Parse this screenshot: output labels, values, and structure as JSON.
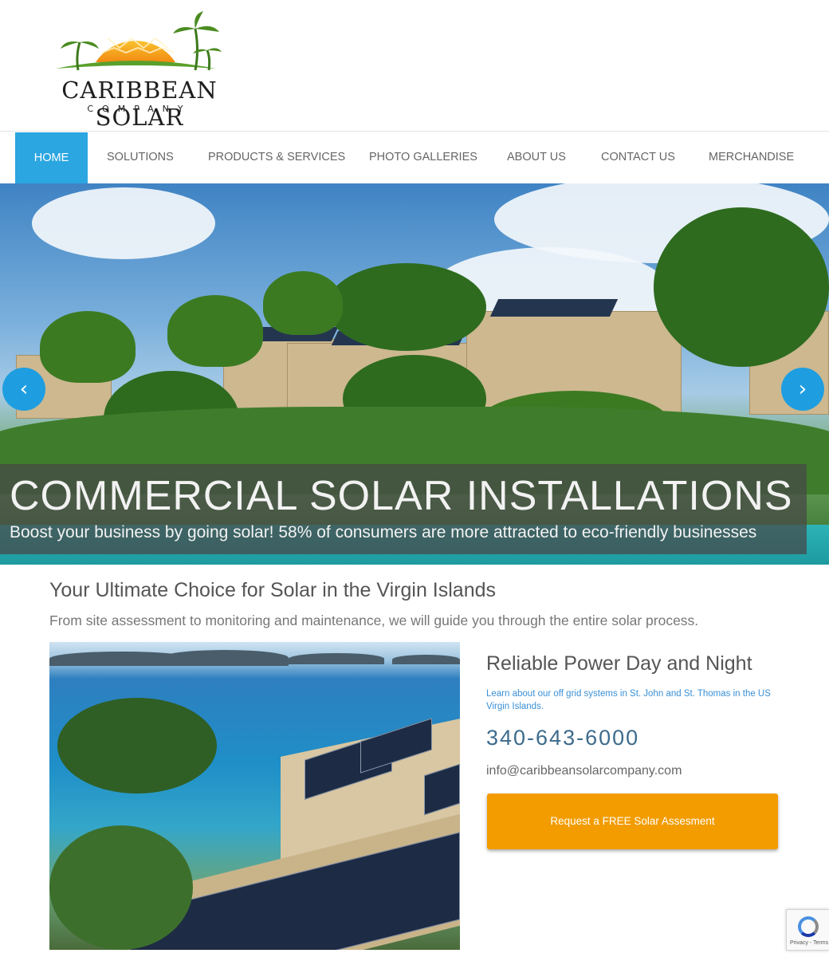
{
  "logo": {
    "name": "CARIBBEAN SOLAR",
    "sub": "COMPANY"
  },
  "nav": {
    "items": [
      {
        "label": "HOME",
        "active": true
      },
      {
        "label": "SOLUTIONS",
        "active": false
      },
      {
        "label": "PRODUCTS & SERVICES",
        "active": false
      },
      {
        "label": "PHOTO GALLERIES",
        "active": false
      },
      {
        "label": "ABOUT US",
        "active": false
      },
      {
        "label": "CONTACT US",
        "active": false
      },
      {
        "label": "MERCHANDISE",
        "active": false
      }
    ]
  },
  "hero": {
    "title": "COMMERCIAL SOLAR INSTALLATIONS",
    "subtitle": "Boost your business by going solar! 58% of consumers are more attracted to eco-friendly businesses",
    "prev_icon": "chevron-left-icon",
    "next_icon": "chevron-right-icon",
    "prev_glyph": "‹",
    "next_glyph": "›"
  },
  "intro": {
    "headline": "Your Ultimate Choice for Solar in the Virgin Islands",
    "subline": "From site assessment to monitoring and maintenance, we will guide you through the entire solar process."
  },
  "side": {
    "title": "Reliable Power Day and Night",
    "text": "Learn about our off grid systems in St. John and St. Thomas in the US Virgin Islands.",
    "phone": "340-643-6000",
    "email": "info@caribbeansolarcompany.com",
    "cta_label": "Request a FREE Solar Assesment"
  },
  "recaptcha": {
    "text": "Privacy - Terms"
  },
  "colors": {
    "accent": "#2ba6e1",
    "cta": "#f29c00",
    "arrow": "#1e9ee0",
    "link": "#3a90d6"
  }
}
